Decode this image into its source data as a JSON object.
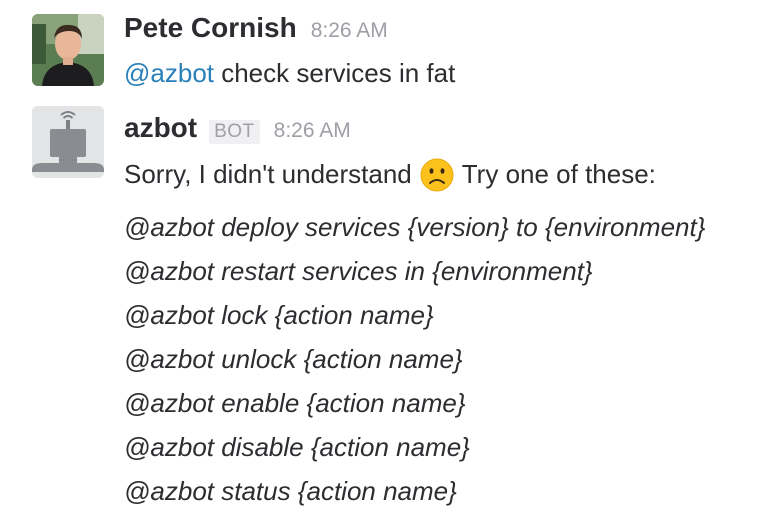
{
  "messages": [
    {
      "username": "Pete Cornish",
      "time": "8:26 AM",
      "mention": "@azbot",
      "text": " check services in fat"
    },
    {
      "username": "azbot",
      "badge": "BOT",
      "time": "8:26 AM",
      "intro_before": "Sorry, I didn't understand",
      "emoji": "slightly-frowning-face",
      "intro_after": "Try one of these:",
      "commands": [
        "@azbot deploy services {version} to {environment}",
        "@azbot restart services in {environment}",
        "@azbot lock {action name}",
        "@azbot unlock {action name}",
        "@azbot enable {action name}",
        "@azbot disable {action name}",
        "@azbot status {action name}"
      ]
    }
  ],
  "colors": {
    "mention": "#2a80b9",
    "timestamp": "#9e9ea6",
    "text": "#2c2d30"
  }
}
